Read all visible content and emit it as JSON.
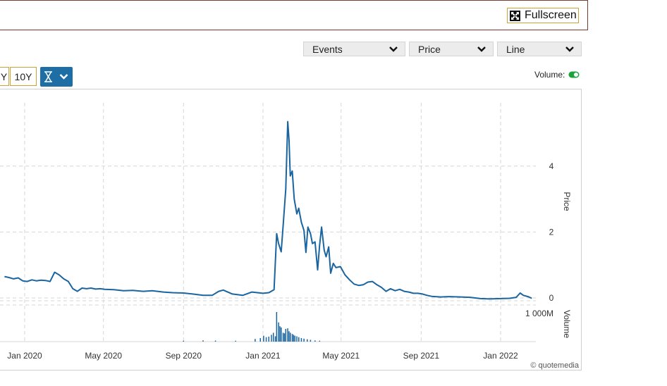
{
  "toolbar": {
    "fullscreen_label": "Fullscreen",
    "dropdowns": [
      {
        "label": "Events"
      },
      {
        "label": "Price"
      },
      {
        "label": "Line"
      }
    ],
    "ranges": [
      {
        "label": "Y"
      },
      {
        "label": "10Y"
      }
    ],
    "volume_label": "Volume:",
    "volume_on": true,
    "accent": "#1e6ea6",
    "toggle_color": "#1aa33a"
  },
  "chart_data": {
    "type": "line",
    "series": [
      {
        "line_color": "#1a65a0",
        "points": [
          [
            "2019-12-01",
            0.65
          ],
          [
            "2019-12-08",
            0.62
          ],
          [
            "2019-12-15",
            0.58
          ],
          [
            "2019-12-22",
            0.61
          ],
          [
            "2019-12-29",
            0.52
          ],
          [
            "2020-01-05",
            0.5
          ],
          [
            "2020-01-12",
            0.55
          ],
          [
            "2020-01-19",
            0.52
          ],
          [
            "2020-01-26",
            0.54
          ],
          [
            "2020-02-02",
            0.53
          ],
          [
            "2020-02-09",
            0.5
          ],
          [
            "2020-02-16",
            0.78
          ],
          [
            "2020-02-23",
            0.7
          ],
          [
            "2020-03-01",
            0.58
          ],
          [
            "2020-03-08",
            0.5
          ],
          [
            "2020-03-15",
            0.28
          ],
          [
            "2020-03-22",
            0.2
          ],
          [
            "2020-03-29",
            0.3
          ],
          [
            "2020-04-05",
            0.28
          ],
          [
            "2020-04-12",
            0.3
          ],
          [
            "2020-04-19",
            0.27
          ],
          [
            "2020-04-26",
            0.28
          ],
          [
            "2020-05-03",
            0.26
          ],
          [
            "2020-05-17",
            0.25
          ],
          [
            "2020-06-01",
            0.22
          ],
          [
            "2020-06-15",
            0.23
          ],
          [
            "2020-07-01",
            0.2
          ],
          [
            "2020-07-15",
            0.22
          ],
          [
            "2020-08-01",
            0.18
          ],
          [
            "2020-08-15",
            0.16
          ],
          [
            "2020-09-01",
            0.15
          ],
          [
            "2020-09-15",
            0.12
          ],
          [
            "2020-10-01",
            0.08
          ],
          [
            "2020-10-15",
            0.08
          ],
          [
            "2020-10-25",
            0.2
          ],
          [
            "2020-11-01",
            0.24
          ],
          [
            "2020-11-15",
            0.12
          ],
          [
            "2020-12-01",
            0.08
          ],
          [
            "2020-12-15",
            0.18
          ],
          [
            "2021-01-01",
            0.14
          ],
          [
            "2021-01-10",
            0.16
          ],
          [
            "2021-01-18",
            0.25
          ],
          [
            "2021-01-22",
            1.95
          ],
          [
            "2021-01-25",
            1.65
          ],
          [
            "2021-01-29",
            1.4
          ],
          [
            "2021-02-01",
            2.2
          ],
          [
            "2021-02-05",
            3.3
          ],
          [
            "2021-02-08",
            5.35
          ],
          [
            "2021-02-10",
            4.8
          ],
          [
            "2021-02-12",
            3.7
          ],
          [
            "2021-02-15",
            3.85
          ],
          [
            "2021-02-18",
            3.0
          ],
          [
            "2021-02-22",
            2.55
          ],
          [
            "2021-02-25",
            2.72
          ],
          [
            "2021-03-01",
            2.3
          ],
          [
            "2021-03-05",
            2.05
          ],
          [
            "2021-03-08",
            1.38
          ],
          [
            "2021-03-11",
            2.15
          ],
          [
            "2021-03-15",
            1.95
          ],
          [
            "2021-03-18",
            1.65
          ],
          [
            "2021-03-22",
            1.7
          ],
          [
            "2021-03-26",
            0.85
          ],
          [
            "2021-03-29",
            1.6
          ],
          [
            "2021-04-01",
            2.15
          ],
          [
            "2021-04-05",
            1.45
          ],
          [
            "2021-04-08",
            1.25
          ],
          [
            "2021-04-12",
            1.55
          ],
          [
            "2021-04-15",
            0.75
          ],
          [
            "2021-04-19",
            1.05
          ],
          [
            "2021-04-23",
            0.92
          ],
          [
            "2021-04-30",
            0.95
          ],
          [
            "2021-05-07",
            0.7
          ],
          [
            "2021-05-14",
            0.55
          ],
          [
            "2021-05-21",
            0.42
          ],
          [
            "2021-05-28",
            0.38
          ],
          [
            "2021-06-04",
            0.4
          ],
          [
            "2021-06-11",
            0.48
          ],
          [
            "2021-06-18",
            0.5
          ],
          [
            "2021-06-25",
            0.4
          ],
          [
            "2021-07-02",
            0.32
          ],
          [
            "2021-07-09",
            0.2
          ],
          [
            "2021-07-16",
            0.28
          ],
          [
            "2021-07-23",
            0.22
          ],
          [
            "2021-07-30",
            0.26
          ],
          [
            "2021-08-06",
            0.2
          ],
          [
            "2021-08-13",
            0.18
          ],
          [
            "2021-08-20",
            0.14
          ],
          [
            "2021-08-27",
            0.14
          ],
          [
            "2021-09-03",
            0.12
          ],
          [
            "2021-09-10",
            0.08
          ],
          [
            "2021-09-17",
            0.05
          ],
          [
            "2021-10-01",
            0.03
          ],
          [
            "2021-10-15",
            0.04
          ],
          [
            "2021-11-01",
            0.03
          ],
          [
            "2021-11-15",
            0.02
          ],
          [
            "2021-12-01",
            -0.02
          ],
          [
            "2021-12-15",
            -0.03
          ],
          [
            "2022-01-01",
            -0.02
          ],
          [
            "2022-01-15",
            -0.01
          ],
          [
            "2022-01-25",
            0.02
          ],
          [
            "2022-01-31",
            0.15
          ],
          [
            "2022-02-05",
            0.08
          ],
          [
            "2022-02-12",
            0.04
          ],
          [
            "2022-02-18",
            -0.01
          ]
        ]
      }
    ],
    "volume": {
      "bar_color": "#1a65a0",
      "bars": [
        [
          "2020-09-01",
          30
        ],
        [
          "2020-10-01",
          40
        ],
        [
          "2020-10-20",
          35
        ],
        [
          "2020-11-20",
          30
        ],
        [
          "2020-12-20",
          90
        ],
        [
          "2020-12-28",
          120
        ],
        [
          "2021-01-02",
          200
        ],
        [
          "2021-01-06",
          150
        ],
        [
          "2021-01-10",
          170
        ],
        [
          "2021-01-14",
          230
        ],
        [
          "2021-01-17",
          300
        ],
        [
          "2021-01-20",
          180
        ],
        [
          "2021-01-22",
          1000
        ],
        [
          "2021-01-25",
          650
        ],
        [
          "2021-01-27",
          520
        ],
        [
          "2021-01-29",
          480
        ],
        [
          "2021-02-01",
          300
        ],
        [
          "2021-02-03",
          280
        ],
        [
          "2021-02-05",
          430
        ],
        [
          "2021-02-08",
          450
        ],
        [
          "2021-02-10",
          350
        ],
        [
          "2021-02-12",
          300
        ],
        [
          "2021-02-15",
          260
        ],
        [
          "2021-02-17",
          230
        ],
        [
          "2021-02-19",
          200
        ],
        [
          "2021-02-22",
          180
        ],
        [
          "2021-02-25",
          150
        ],
        [
          "2021-03-01",
          120
        ],
        [
          "2021-03-05",
          100
        ],
        [
          "2021-03-10",
          80
        ],
        [
          "2021-03-15",
          60
        ],
        [
          "2021-03-22",
          40
        ],
        [
          "2021-03-29",
          30
        ]
      ]
    },
    "x_ticks": [
      "Jan 2020",
      "May 2020",
      "Sep 2020",
      "Jan 2021",
      "May 2021",
      "Sep 2021",
      "Jan 2022"
    ],
    "x_tick_dates": [
      "2020-01-01",
      "2020-05-01",
      "2020-09-01",
      "2021-01-01",
      "2021-05-01",
      "2021-09-01",
      "2022-01-01"
    ],
    "y_ticks": [
      "0",
      "2",
      "4"
    ],
    "y_tick_values": [
      0,
      2,
      4
    ],
    "ylabel": "Price",
    "volume_label": "Volume",
    "volume_tick": "1 000M",
    "credit": "© quotemedia",
    "grid": true
  }
}
